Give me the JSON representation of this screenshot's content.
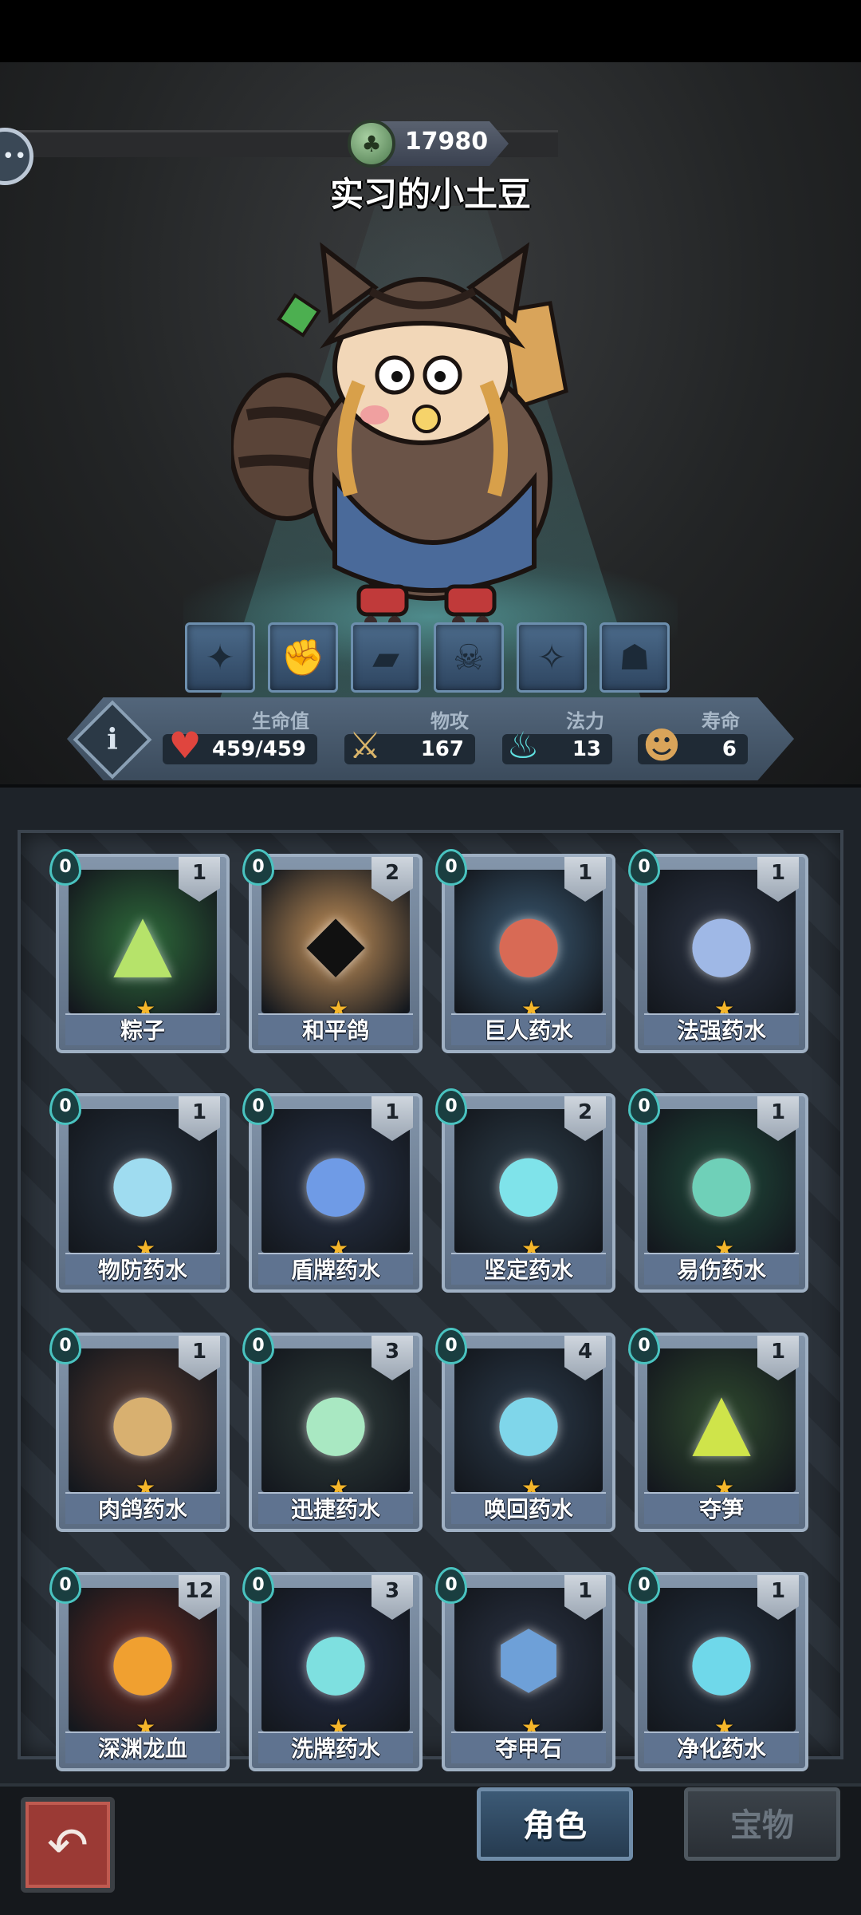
{
  "player": {
    "currency": "17980",
    "name": "实习的小土豆"
  },
  "skills": [
    "bone-foot-icon",
    "fist-icon",
    "boot-icon",
    "skull-icon",
    "rune-icon",
    "monster-icon"
  ],
  "stats": {
    "hp": {
      "label": "生命值",
      "value": "459/459",
      "icon": "heart-icon"
    },
    "atk": {
      "label": "物攻",
      "value": "167",
      "icon": "sword-icon"
    },
    "mana": {
      "label": "法力",
      "value": "13",
      "icon": "flame-icon"
    },
    "life": {
      "label": "寿命",
      "value": "6",
      "icon": "character-head-icon"
    }
  },
  "cards": [
    {
      "name": "粽子",
      "cost": "0",
      "count": "1",
      "glyph": "▲",
      "bg": "#2e6b3a",
      "fg": "#b6e36a"
    },
    {
      "name": "和平鸽",
      "cost": "0",
      "count": "2",
      "glyph": "◆",
      "bg": "#c7935a",
      "fg": "#111111"
    },
    {
      "name": "巨人药水",
      "cost": "0",
      "count": "1",
      "glyph": "●",
      "bg": "#3b5a73",
      "fg": "#d86a55"
    },
    {
      "name": "法强药水",
      "cost": "0",
      "count": "1",
      "glyph": "●",
      "bg": "#2c3444",
      "fg": "#9fb8e6"
    },
    {
      "name": "物防药水",
      "cost": "0",
      "count": "1",
      "glyph": "●",
      "bg": "#27323f",
      "fg": "#9fdcf0"
    },
    {
      "name": "盾牌药水",
      "cost": "0",
      "count": "1",
      "glyph": "●",
      "bg": "#29344a",
      "fg": "#6f9be6"
    },
    {
      "name": "坚定药水",
      "cost": "0",
      "count": "2",
      "glyph": "●",
      "bg": "#2d3d49",
      "fg": "#7fe3ea"
    },
    {
      "name": "易伤药水",
      "cost": "0",
      "count": "1",
      "glyph": "●",
      "bg": "#1f4a3a",
      "fg": "#6fd0b8"
    },
    {
      "name": "肉鸽药水",
      "cost": "0",
      "count": "1",
      "glyph": "●",
      "bg": "#5a3a2e",
      "fg": "#d8b070"
    },
    {
      "name": "迅捷药水",
      "cost": "0",
      "count": "3",
      "glyph": "●",
      "bg": "#2f3d3b",
      "fg": "#a9e8c2"
    },
    {
      "name": "唤回药水",
      "cost": "0",
      "count": "4",
      "glyph": "●",
      "bg": "#2b3a4a",
      "fg": "#7fd6ea"
    },
    {
      "name": "夺笋",
      "cost": "0",
      "count": "1",
      "glyph": "▲",
      "bg": "#2f4a2e",
      "fg": "#cfe44a"
    },
    {
      "name": "深渊龙血",
      "cost": "0",
      "count": "12",
      "glyph": "●",
      "bg": "#6b2a20",
      "fg": "#f0a030"
    },
    {
      "name": "洗牌药水",
      "cost": "0",
      "count": "3",
      "glyph": "●",
      "bg": "#252d47",
      "fg": "#7ee0e0"
    },
    {
      "name": "夺甲石",
      "cost": "0",
      "count": "1",
      "glyph": "⬢",
      "bg": "#2b3344",
      "fg": "#6ea0d8"
    },
    {
      "name": "净化药水",
      "cost": "0",
      "count": "1",
      "glyph": "●",
      "bg": "#24303f",
      "fg": "#6fd8ea"
    }
  ],
  "nav": {
    "back_icon": "back-arrow-icon",
    "tab_role": "角色",
    "tab_treasure": "宝物"
  },
  "colors": {
    "accent": "#49c3c0",
    "star": "#f5b62a",
    "back_button": "#9b3a35"
  }
}
